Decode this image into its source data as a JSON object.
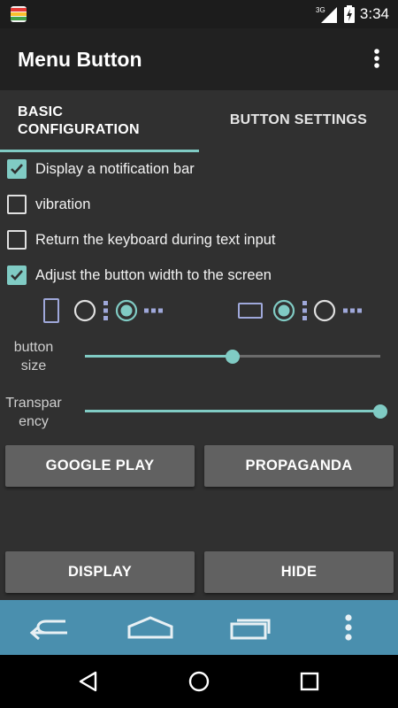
{
  "status_bar": {
    "time": "3:34",
    "network": "3G",
    "icons": [
      "app-notification-icon",
      "signal-icon",
      "battery-icon"
    ]
  },
  "app_bar": {
    "title": "Menu Button",
    "overflow_icon": "more-vertical-icon"
  },
  "tabs": [
    {
      "label_line1": "BASIC",
      "label_line2": "CONFIGURATION",
      "selected": true
    },
    {
      "label": "BUTTON SETTINGS",
      "selected": false
    }
  ],
  "options": [
    {
      "label": "Display a notification bar",
      "checked": true
    },
    {
      "label": "vibration",
      "checked": false
    },
    {
      "label": "Return the keyboard during text input",
      "checked": false
    },
    {
      "label": "Adjust the button width to the screen",
      "checked": true
    }
  ],
  "layouts": {
    "portrait_selected": "right",
    "landscape_selected": "left"
  },
  "sliders": [
    {
      "label_line1": "button",
      "label_line2": "size",
      "value": 0.5
    },
    {
      "label_line1": "Transpar",
      "label_line2": "ency",
      "value": 1.0
    }
  ],
  "buttons": {
    "google_play": "GOOGLE PLAY",
    "propaganda": "PROPAGANDA",
    "display": "DISPLAY",
    "hide": "HIDE"
  },
  "menu_bar": {
    "icons": [
      "back-arrow-icon",
      "home-icon",
      "recent-apps-icon",
      "more-vertical-icon"
    ]
  },
  "nav_bar": {
    "icons": [
      "nav-back-icon",
      "nav-home-icon",
      "nav-recents-icon"
    ]
  },
  "colors": {
    "accent": "#80cbc4",
    "background": "#303030",
    "app_bar": "#212121",
    "button": "#616161",
    "menu_bar": "#4a8fae"
  }
}
